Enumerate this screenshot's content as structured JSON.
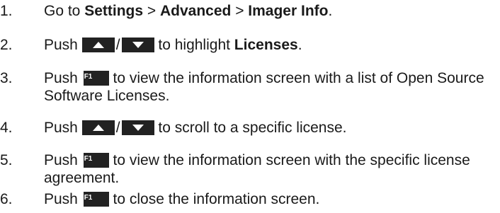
{
  "steps": [
    {
      "num": "1.",
      "t1": "Go to ",
      "b1": "Settings",
      "t2": " > ",
      "b2": "Advanced",
      "t3": " > ",
      "b3": "Imager Info",
      "t4": "."
    },
    {
      "num": "2.",
      "t1": "Push ",
      "slash": "/",
      "t2": " to highlight ",
      "b1": "Licenses",
      "t3": "."
    },
    {
      "num": "3.",
      "t1": "Push ",
      "t2": " to view the information screen with a list of Open Source Software Licenses."
    },
    {
      "num": "4.",
      "t1": "Push ",
      "slash": "/",
      "t2": " to scroll to a specific license."
    },
    {
      "num": "5.",
      "t1": "Push ",
      "t2": " to view the information screen with the specific license agreement."
    },
    {
      "num": "6.",
      "t1": "Push ",
      "t2": " to close the information screen."
    }
  ],
  "keys": {
    "up_icon": "arrow-up-icon",
    "down_icon": "arrow-down-icon",
    "f1_label": "F1",
    "key_color": "#222222"
  }
}
